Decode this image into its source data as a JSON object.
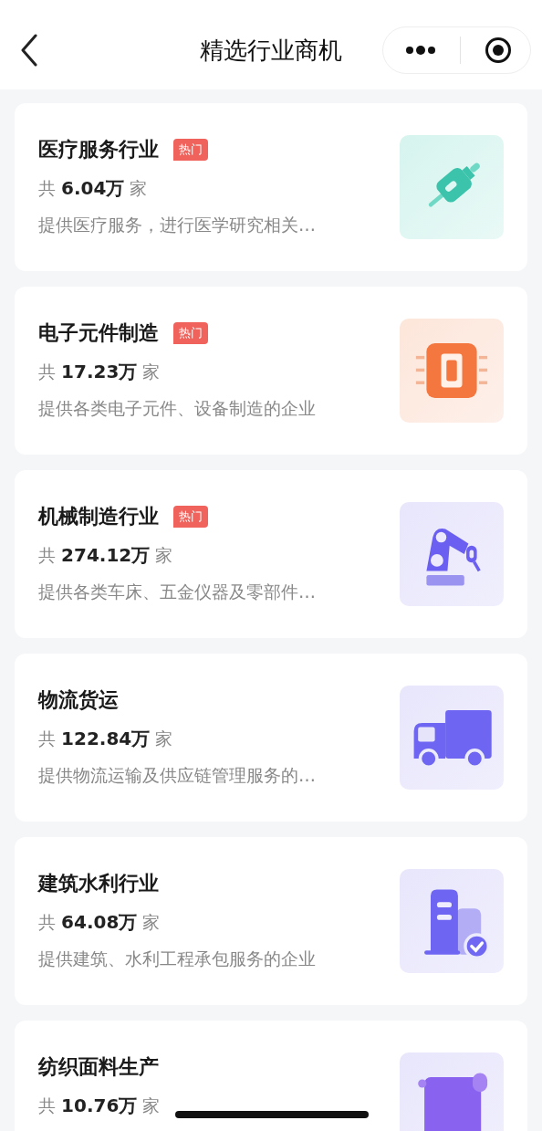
{
  "nav_bar": {
    "title": "精选行业商机"
  },
  "industries": [
    {
      "name": "医疗服务行业",
      "hot": true,
      "tag": "热门",
      "count": "共 **6.04万** 家",
      "description": "提供医疗服务，进行医学研究相关…",
      "kind": "syringe"
    },
    {
      "name": "电子元件制造",
      "hot": true,
      "tag": "热门",
      "count": "共 **17.23万** 家",
      "description": "提供各类电子元件、设备制造的企业",
      "kind": "chip"
    },
    {
      "name": "机械制造行业",
      "hot": true,
      "tag": "热门",
      "count": "共 **274.12万** 家",
      "description": "提供各类车床、五金仪器及零部件…",
      "kind": "robot-arm"
    },
    {
      "name": "物流货运",
      "hot": false,
      "count": "共 **122.84万** 家",
      "description": "提供物流运输及供应链管理服务的…",
      "kind": "truck"
    },
    {
      "name": "建筑水利行业",
      "hot": false,
      "count": "共 **64.08万** 家",
      "description": "提供建筑、水利工程承包服务的企业",
      "kind": "building"
    },
    {
      "name": "纺织面料生产",
      "hot": false,
      "count": "共 **10.76万** 家",
      "kind": "scroll"
    }
  ]
}
